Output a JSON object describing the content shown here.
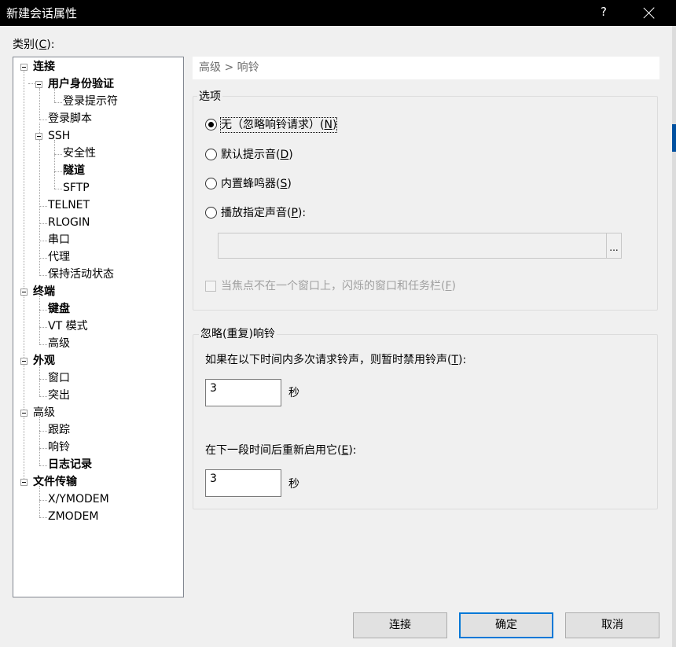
{
  "window": {
    "title": "新建会话属性",
    "help": "?"
  },
  "category": {
    "label_prefix": "类别(",
    "hotkey": "C",
    "label_suffix": "):"
  },
  "tree": {
    "connection": "连接",
    "user_auth": "用户身份验证",
    "login_prompt": "登录提示符",
    "login_script": "登录脚本",
    "ssh": "SSH",
    "security": "安全性",
    "tunnel": "隧道",
    "sftp": "SFTP",
    "telnet": "TELNET",
    "rlogin": "RLOGIN",
    "serial": "串口",
    "proxy": "代理",
    "keepalive": "保持活动状态",
    "terminal": "终端",
    "keyboard": "键盘",
    "vt_mode": "VT 模式",
    "advanced_term": "高级",
    "appearance": "外观",
    "window": "窗口",
    "highlight": "突出",
    "advanced": "高级",
    "trace": "跟踪",
    "bell": "响铃",
    "logging": "日志记录",
    "file_transfer": "文件传输",
    "xymodem": "X/YMODEM",
    "zmodem": "ZMODEM"
  },
  "breadcrumb": "高级 > 响铃",
  "options": {
    "title": "选项",
    "none": {
      "text": "无（忽略响铃请求）(",
      "key": "N",
      "end": ")"
    },
    "default_sound": {
      "text": "默认提示音(",
      "key": "D",
      "end": ")"
    },
    "builtin_buzzer": {
      "text": "内置蜂鸣器(",
      "key": "S",
      "end": ")"
    },
    "play_sound": {
      "text": "播放指定声音(",
      "key": "P",
      "end": "):"
    },
    "browse": "...",
    "flash": {
      "text": "当焦点不在一个窗口上，闪烁的窗口和任务栏(",
      "key": "F",
      "end": ")"
    }
  },
  "ignore": {
    "title": "忽略(重复)响铃",
    "desc": {
      "text": "如果在以下时间内多次请求铃声，则暂时禁用铃声(",
      "key": "T",
      "end": "):"
    },
    "value1": "3",
    "unit1": "秒",
    "reenable": {
      "text": "在下一段时间后重新启用它(",
      "key": "E",
      "end": "):"
    },
    "value2": "3",
    "unit2": "秒"
  },
  "buttons": {
    "connect": "连接",
    "ok": "确定",
    "cancel": "取消"
  }
}
